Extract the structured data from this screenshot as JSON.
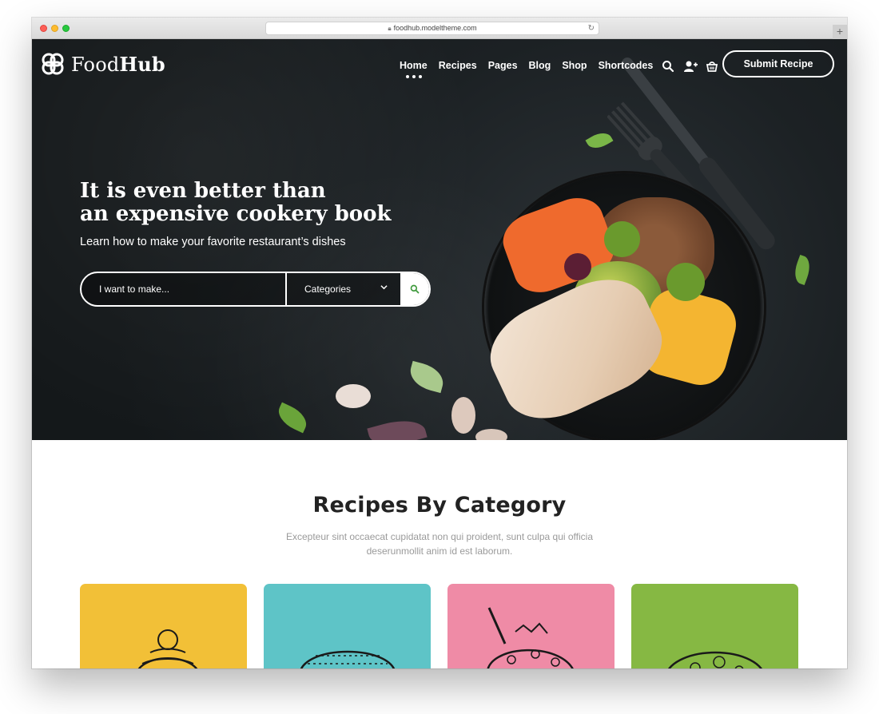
{
  "browser": {
    "url": "foodhub.modeltheme.com"
  },
  "header": {
    "logo_light": "Food",
    "logo_bold": "Hub",
    "nav": [
      "Home",
      "Recipes",
      "Pages",
      "Blog",
      "Shop",
      "Shortcodes"
    ],
    "active_nav": "Home",
    "submit_label": "Submit Recipe",
    "icons": [
      "search-icon",
      "add-user-icon",
      "cart-icon"
    ]
  },
  "hero": {
    "headline_line1": "It is even better than",
    "headline_line2": "an expensive cookery book",
    "subheadline": "Learn how to make your favorite restaurant’s dishes",
    "search_placeholder": "I want to make...",
    "categories_label": "Categories"
  },
  "categories_section": {
    "title": "Recipes By Category",
    "subtitle_line1": "Excepteur sint occaecat cupidatat non qui proident, sunt culpa qui officia",
    "subtitle_line2": "deserunmollit anim id est laborum.",
    "cards": [
      {
        "color": "#f2c037",
        "icon": "dessert-icon"
      },
      {
        "color": "#5ec4c7",
        "icon": "burger-icon"
      },
      {
        "color": "#ef8ba6",
        "icon": "ice-cream-icon"
      },
      {
        "color": "#86b843",
        "icon": "pizza-icon"
      }
    ]
  },
  "colors": {
    "hero_bg": "#1c2124",
    "text_dark": "#222222",
    "muted": "#9a9a9a",
    "search_accent": "#3f9a3d"
  }
}
